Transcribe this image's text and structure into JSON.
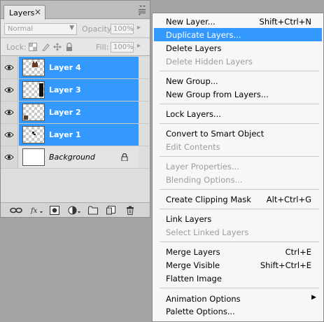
{
  "panel": {
    "tab_label": "Layers",
    "tab_close": "×",
    "blend_mode": "Normal",
    "opacity_label": "Opacity:",
    "opacity_value": "100%",
    "lock_label": "Lock:",
    "fill_label": "Fill:",
    "fill_value": "100%",
    "layers": [
      {
        "name": "Layer 4",
        "selected": true
      },
      {
        "name": "Layer 3",
        "selected": true
      },
      {
        "name": "Layer 2",
        "selected": true
      },
      {
        "name": "Layer 1",
        "selected": true
      },
      {
        "name": "Background",
        "selected": false
      }
    ]
  },
  "menu": {
    "new_layer": {
      "label": "New Layer...",
      "shortcut": "Shift+Ctrl+N"
    },
    "duplicate_layers": {
      "label": "Duplicate Layers..."
    },
    "delete_layers": {
      "label": "Delete Layers"
    },
    "delete_hidden_layers": {
      "label": "Delete Hidden Layers"
    },
    "new_group": {
      "label": "New Group..."
    },
    "new_group_from_layers": {
      "label": "New Group from Layers..."
    },
    "lock_layers": {
      "label": "Lock Layers..."
    },
    "convert_smart_object": {
      "label": "Convert to Smart Object"
    },
    "edit_contents": {
      "label": "Edit Contents"
    },
    "layer_properties": {
      "label": "Layer Properties..."
    },
    "blending_options": {
      "label": "Blending Options..."
    },
    "create_clipping_mask": {
      "label": "Create Clipping Mask",
      "shortcut": "Alt+Ctrl+G"
    },
    "link_layers": {
      "label": "Link Layers"
    },
    "select_linked_layers": {
      "label": "Select Linked Layers"
    },
    "merge_layers": {
      "label": "Merge Layers",
      "shortcut": "Ctrl+E"
    },
    "merge_visible": {
      "label": "Merge Visible",
      "shortcut": "Shift+Ctrl+E"
    },
    "flatten_image": {
      "label": "Flatten Image"
    },
    "animation_options": {
      "label": "Animation Options",
      "submenu": "▶"
    },
    "palette_options": {
      "label": "Palette Options..."
    }
  },
  "colors": {
    "selection": "#3399ff",
    "panel_bg": "#d8d8d8",
    "menu_bg": "#f7f7f7",
    "disabled_text": "#9d9d9d"
  }
}
